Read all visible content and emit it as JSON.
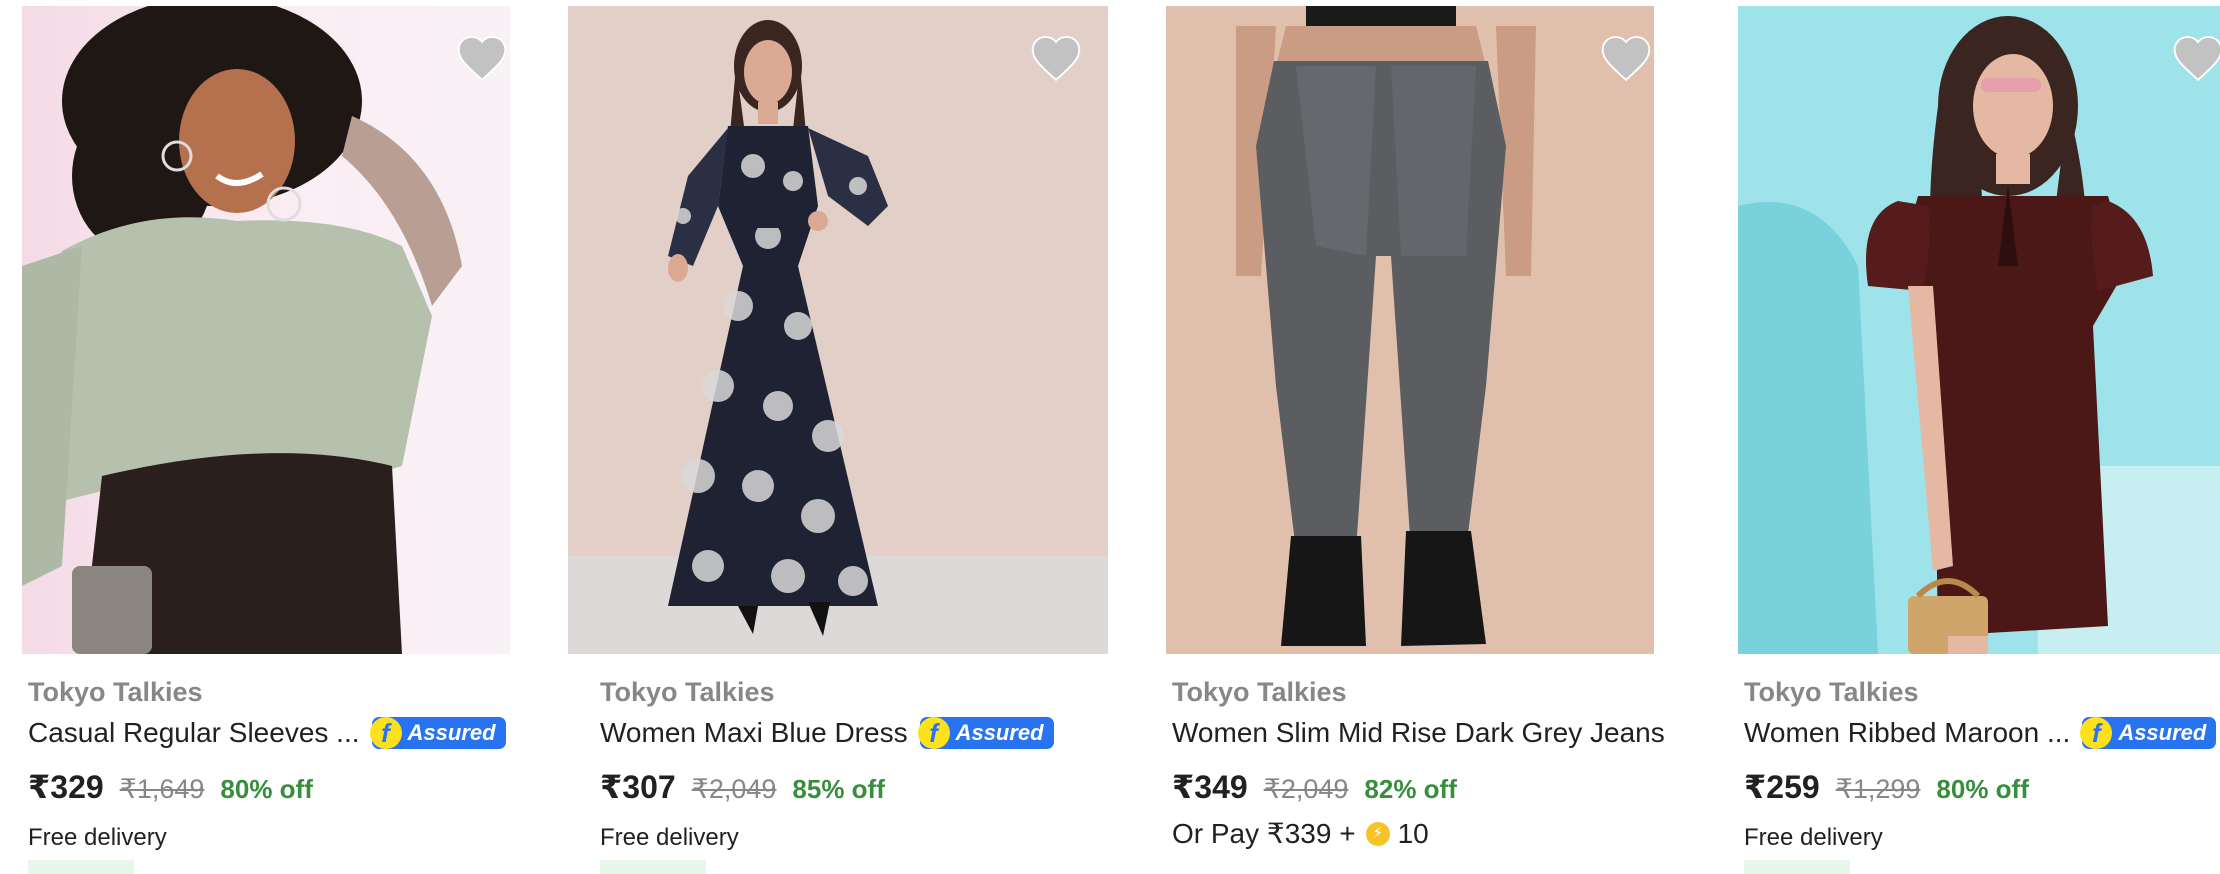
{
  "colors": {
    "brand_gray": "#878787",
    "discount_green": "#388e3c",
    "assured_blue": "#2874f0",
    "assured_yellow": "#ffe11b",
    "wishlist_gray": "#c2c2c2"
  },
  "products": [
    {
      "brand": "Tokyo Talkies",
      "title": "Casual Regular Sleeves ...",
      "assured": true,
      "assured_label": "Assured",
      "price": "₹329",
      "mrp": "₹1,649",
      "discount": "80% off",
      "delivery": "Free delivery",
      "image_icon": "model-green-top-photo"
    },
    {
      "brand": "Tokyo Talkies",
      "title": "Women Maxi Blue Dress",
      "assured": true,
      "assured_label": "Assured",
      "price": "₹307",
      "mrp": "₹2,049",
      "discount": "85% off",
      "delivery": "Free delivery",
      "image_icon": "model-floral-maxi-dress-photo"
    },
    {
      "brand": "Tokyo Talkies",
      "title": "Women Slim Mid Rise Dark Grey Jeans",
      "assured": false,
      "price": "₹349",
      "mrp": "₹2,049",
      "discount": "82% off",
      "pay_prefix": "Or Pay ₹339 +",
      "supercoins": "10",
      "image_icon": "model-grey-jeans-photo"
    },
    {
      "brand": "Tokyo Talkies",
      "title": "Women Ribbed Maroon ...",
      "assured": true,
      "assured_label": "Assured",
      "price": "₹259",
      "mrp": "₹1,299",
      "discount": "80% off",
      "delivery": "Free delivery",
      "image_icon": "model-maroon-dress-photo"
    }
  ]
}
